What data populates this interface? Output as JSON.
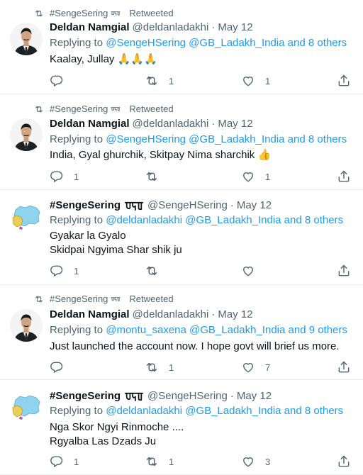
{
  "tweets": [
    {
      "retweet": "#SengeSering",
      "retweet_suffix": "Retweeted",
      "name": "Deldan Namgial",
      "handle": "@deldanladakhi",
      "dot": "·",
      "time": "May 12",
      "reply_prefix": "Replying to",
      "reply_to": "@SengeHSering @GB_Ladakh_India and 8 others",
      "text": [
        "Kaalay, Jullay 🙏🙏🙏"
      ],
      "reply_count": "",
      "retweet_count": "1",
      "like_count": "1",
      "avatar": "person"
    },
    {
      "retweet": "#SengeSering",
      "retweet_suffix": "Retweeted",
      "name": "Deldan Namgial",
      "handle": "@deldanladakhi",
      "dot": "·",
      "time": "May 12",
      "reply_prefix": "Replying to",
      "reply_to": "@SengeHSering @GB_Ladakh_India and 8 others",
      "text": [
        "India, Gyal ghurchik, Skitpay Nima sharchik 👍"
      ],
      "reply_count": "1",
      "retweet_count": "",
      "like_count": "1",
      "avatar": "person"
    },
    {
      "retweet": "",
      "retweet_suffix": "",
      "name": "#SengeSering",
      "handle": "@SengeHSering",
      "dot": "·",
      "time": "May 12",
      "reply_prefix": "Replying to",
      "reply_to": "@deldanladakhi @GB_Ladakh_India and 8 others",
      "text": [
        "Gyakar la Gyalo",
        "Skidpai Ngyima Shar shik ju"
      ],
      "reply_count": "1",
      "retweet_count": "",
      "like_count": "",
      "avatar": "map"
    },
    {
      "retweet": "#SengeSering",
      "retweet_suffix": "Retweeted",
      "name": "Deldan Namgial",
      "handle": "@deldanladakhi",
      "dot": "·",
      "time": "May 12",
      "reply_prefix": "Replying to",
      "reply_to": "@montu_saxena @GB_Ladakh_India and 9 others",
      "text": [
        "Just launched the account now. I hope govt will brief us more."
      ],
      "reply_count": "",
      "retweet_count": "1",
      "like_count": "7",
      "avatar": "person"
    },
    {
      "retweet": "",
      "retweet_suffix": "",
      "name": "#SengeSering",
      "handle": "@SengeHSering",
      "dot": "·",
      "time": "May 12",
      "reply_prefix": "Replying to",
      "reply_to": "@deldanladakhi @GB_Ladakh_India and 8 others",
      "text": [
        "Nga Skor Ngyi Rinmoche ....",
        "Rgyalba Las Dzads Ju"
      ],
      "reply_count": "1",
      "retweet_count": "1",
      "like_count": "3",
      "avatar": "map"
    }
  ],
  "colors": {
    "link": "#1d9bf0",
    "muted": "#536471",
    "text": "#0f1419",
    "border": "#e6ecf0"
  },
  "icons": [
    "retweet-icon",
    "reply-icon",
    "like-icon",
    "share-icon",
    "tibetan-script"
  ]
}
